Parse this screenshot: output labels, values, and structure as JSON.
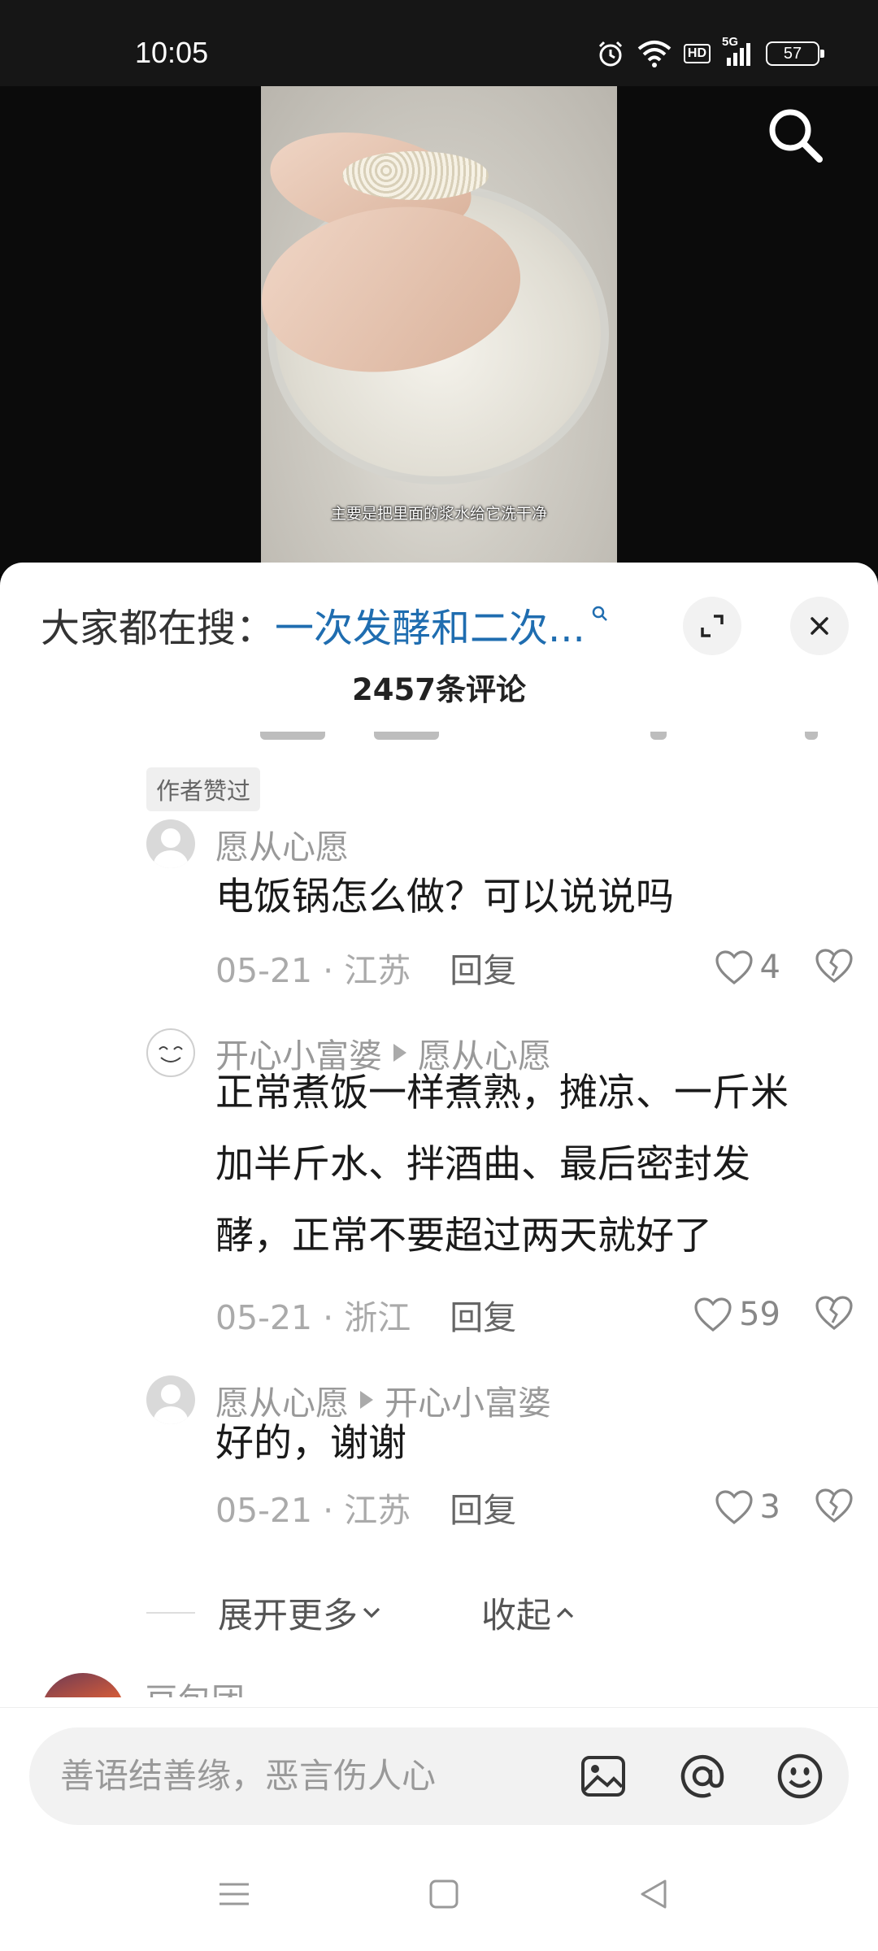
{
  "status_bar": {
    "time": "10:05",
    "network_type": "5G",
    "hd_label": "HD",
    "battery": "57"
  },
  "video": {
    "caption": "主要是把里面的浆水给它洗干净"
  },
  "sheet": {
    "hot_search_prefix": "大家都在搜：",
    "hot_search_query": "一次发酵和二次...",
    "comment_count": "2457条评论"
  },
  "badge": {
    "author_liked": "作者赞过"
  },
  "replies": [
    {
      "username": "愿从心愿",
      "reply_to": "",
      "text_lines": [
        "电饭锅怎么做？可以说说吗"
      ],
      "date_location": "05-21 · 江苏",
      "reply_label": "回复",
      "likes": "4"
    },
    {
      "username": "开心小富婆",
      "reply_to": "愿从心愿",
      "text_lines": [
        "正常煮饭一样煮熟，摊凉、一斤米",
        "加半斤水、拌酒曲、最后密封发",
        "酵，正常不要超过两天就好了"
      ],
      "date_location": "05-21 · 浙江",
      "reply_label": "回复",
      "likes": "59"
    },
    {
      "username": "愿从心愿",
      "reply_to": "开心小富婆",
      "text_lines": [
        "好的，谢谢"
      ],
      "date_location": "05-21 · 江苏",
      "reply_label": "回复",
      "likes": "3"
    }
  ],
  "thread_controls": {
    "expand_more": "展开更多",
    "collapse": "收起"
  },
  "next_comment": {
    "username": "豆包团"
  },
  "input": {
    "placeholder": "善语结善缘，恶言伤人心"
  },
  "icons": {
    "top_right": "search-icon",
    "sheet_buttons": [
      "expand-icon",
      "close-icon"
    ],
    "input_bar": [
      "image-icon",
      "at-icon",
      "emoji-icon"
    ],
    "nav": [
      "menu-icon",
      "home-icon",
      "back-icon"
    ]
  }
}
